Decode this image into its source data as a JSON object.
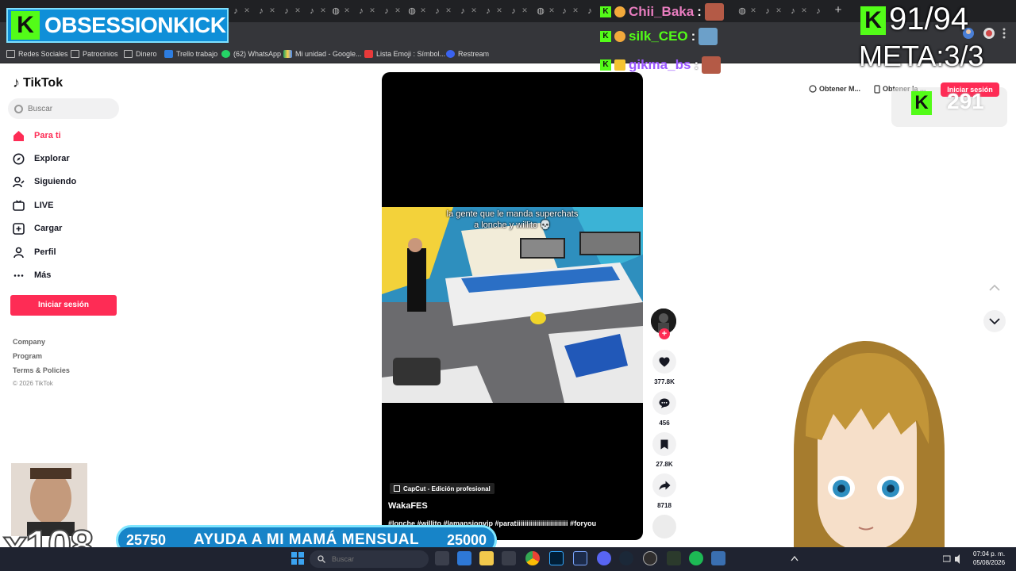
{
  "overlay": {
    "channel_name": "OBSESSIONKICK",
    "counter": "91/94",
    "meta": "META:3/3",
    "panel_count": "291",
    "multiplier": "x108",
    "chat": [
      {
        "user": "Chii_Baka",
        "colon": ":",
        "color": "#e87dbf"
      },
      {
        "user": "silk_CEO",
        "colon": ":",
        "color": "#53fc18"
      },
      {
        "user": "gikma_bs",
        "colon": ":",
        "color": "#9b59ff"
      }
    ],
    "goal": {
      "left": "25750",
      "label": "AYUDA A MI MAMÁ MENSUAL",
      "right": "25000"
    }
  },
  "browser": {
    "bookmarks": [
      {
        "label": "Redes Sociales",
        "icon": "folder-icon"
      },
      {
        "label": "Patrocinios",
        "icon": "folder-icon"
      },
      {
        "label": "Dinero",
        "icon": "folder-icon"
      },
      {
        "label": "Trello trabajo",
        "icon": "trello-icon"
      },
      {
        "label": "(62) WhatsApp",
        "icon": "whatsapp-icon"
      },
      {
        "label": "Mi unidad - Google...",
        "icon": "drive-icon"
      },
      {
        "label": "Lista Emoji : Símbol...",
        "icon": "bolt-icon"
      },
      {
        "label": "Restream",
        "icon": "restream-icon"
      }
    ]
  },
  "tiktok": {
    "logo": "TikTok",
    "search_placeholder": "Buscar",
    "nav": [
      {
        "label": "Para ti",
        "icon": "home-icon",
        "active": true
      },
      {
        "label": "Explorar",
        "icon": "compass-icon",
        "active": false
      },
      {
        "label": "Siguiendo",
        "icon": "following-icon",
        "active": false
      },
      {
        "label": "LIVE",
        "icon": "live-icon",
        "active": false
      },
      {
        "label": "Cargar",
        "icon": "upload-icon",
        "active": false
      },
      {
        "label": "Perfil",
        "icon": "profile-icon",
        "active": false
      },
      {
        "label": "Más",
        "icon": "more-icon",
        "active": false
      }
    ],
    "login_label": "Iniciar sesión",
    "footer": {
      "company": "Company",
      "program": "Program",
      "terms": "Terms & Policies",
      "copyright": "© 2026 TikTok"
    },
    "top_right": {
      "get_app": "Obtener M...",
      "get_desktop": "Obtener la ...",
      "login": "Iniciar sesión"
    },
    "video": {
      "caption_line1": "la gente que le manda superchats",
      "caption_line2": "a lonche y willito 💀",
      "capcut": "CapCut - Edición profesional",
      "author": "WakaFES",
      "hashtags": "#lonche #willito #lamansionvip #paratiiiiiiiiiiiiiiiiiiiiiiiiii #foryou"
    },
    "actions": {
      "likes": "377.8K",
      "comments": "456",
      "saves": "27.8K",
      "shares": "8718"
    }
  },
  "taskbar": {
    "search_placeholder": "Buscar",
    "time": "07:04 p. m.",
    "date": "05/08/2026"
  }
}
